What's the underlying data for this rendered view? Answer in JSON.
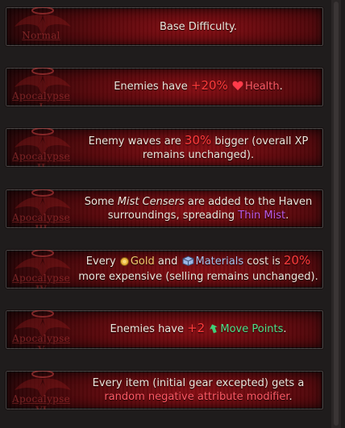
{
  "difficulties": [
    {
      "name": "Normal",
      "numeral": "",
      "parts": [
        {
          "text": "Base Difficulty.",
          "cls": ""
        }
      ]
    },
    {
      "name": "Apocalypse",
      "numeral": "I",
      "parts": [
        {
          "text": "Enemies have ",
          "cls": ""
        },
        {
          "text": "+20%",
          "cls": "red big"
        },
        {
          "text": " ",
          "cls": ""
        },
        {
          "icon": "heart-icon"
        },
        {
          "text": "Health",
          "cls": "pink"
        },
        {
          "text": ".",
          "cls": ""
        }
      ]
    },
    {
      "name": "Apocalypse",
      "numeral": "II",
      "parts": [
        {
          "text": "Enemy waves are ",
          "cls": ""
        },
        {
          "text": "30%",
          "cls": "red big"
        },
        {
          "text": " bigger (overall XP remains unchanged).",
          "cls": ""
        }
      ]
    },
    {
      "name": "Apocalypse",
      "numeral": "III",
      "parts": [
        {
          "text": "Some ",
          "cls": ""
        },
        {
          "text": "Mist Censers",
          "cls": "em"
        },
        {
          "text": " are added to the Haven surroundings, spreading ",
          "cls": ""
        },
        {
          "text": "Thin Mist",
          "cls": "purple"
        },
        {
          "text": ".",
          "cls": ""
        }
      ]
    },
    {
      "name": "Apocalypse",
      "numeral": "IV",
      "parts": [
        {
          "text": "Every ",
          "cls": ""
        },
        {
          "icon": "gold-coin-icon"
        },
        {
          "text": "Gold",
          "cls": "gold"
        },
        {
          "text": " and ",
          "cls": ""
        },
        {
          "icon": "materials-icon"
        },
        {
          "text": "Materials",
          "cls": "blue"
        },
        {
          "text": " cost is ",
          "cls": ""
        },
        {
          "text": "20%",
          "cls": "red big"
        },
        {
          "text": " more expensive (selling remains unchanged).",
          "cls": ""
        }
      ]
    },
    {
      "name": "Apocalypse",
      "numeral": "V",
      "parts": [
        {
          "text": "Enemies have ",
          "cls": ""
        },
        {
          "text": "+2",
          "cls": "red big"
        },
        {
          "text": " ",
          "cls": ""
        },
        {
          "icon": "move-points-icon"
        },
        {
          "text": "Move Points",
          "cls": "green"
        },
        {
          "text": ".",
          "cls": ""
        }
      ]
    },
    {
      "name": "Apocalypse",
      "numeral": "VI",
      "parts": [
        {
          "text": "Every item (initial gear excepted) gets a ",
          "cls": ""
        },
        {
          "text": "random negative attribute modifier",
          "cls": "pink"
        },
        {
          "text": ".",
          "cls": ""
        }
      ]
    }
  ],
  "colors": {
    "accent_red": "#ff3b3b",
    "health_pink": "#ff5a66",
    "mist_purple": "#b85be8",
    "gold": "#f0cd6e",
    "materials_blue": "#a8c4f0",
    "move_green": "#4fe08a"
  }
}
